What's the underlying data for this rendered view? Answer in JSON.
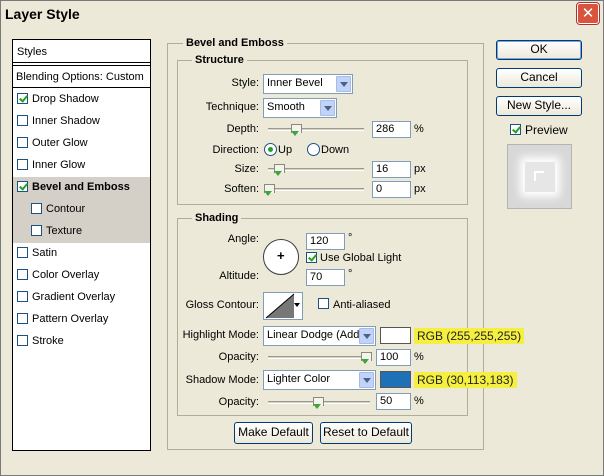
{
  "window": {
    "title": "Layer Style",
    "close_glyph": "✕"
  },
  "styles_list": {
    "header": "Styles",
    "blending": "Blending Options: Custom",
    "items": [
      {
        "label": "Drop Shadow",
        "checked": true
      },
      {
        "label": "Inner Shadow",
        "checked": false
      },
      {
        "label": "Outer Glow",
        "checked": false
      },
      {
        "label": "Inner Glow",
        "checked": false
      },
      {
        "label": "Bevel and Emboss",
        "checked": true,
        "active": true
      },
      {
        "label": "Contour",
        "checked": false,
        "sub": true
      },
      {
        "label": "Texture",
        "checked": false,
        "sub": true
      },
      {
        "label": "Satin",
        "checked": false
      },
      {
        "label": "Color Overlay",
        "checked": false
      },
      {
        "label": "Gradient Overlay",
        "checked": false
      },
      {
        "label": "Pattern Overlay",
        "checked": false
      },
      {
        "label": "Stroke",
        "checked": false
      }
    ]
  },
  "bevel": {
    "title": "Bevel and Emboss",
    "structure": {
      "title": "Structure",
      "style_label": "Style:",
      "style_value": "Inner Bevel",
      "technique_label": "Technique:",
      "technique_value": "Smooth",
      "depth_label": "Depth:",
      "depth_value": "286",
      "depth_unit": "%",
      "direction_label": "Direction:",
      "direction_up": "Up",
      "direction_down": "Down",
      "size_label": "Size:",
      "size_value": "16",
      "size_unit": "px",
      "soften_label": "Soften:",
      "soften_value": "0",
      "soften_unit": "px"
    },
    "shading": {
      "title": "Shading",
      "angle_label": "Angle:",
      "angle_value": "120",
      "angle_unit": "°",
      "global_light_label": "Use Global Light",
      "altitude_label": "Altitude:",
      "altitude_value": "70",
      "altitude_unit": "°",
      "gloss_label": "Gloss Contour:",
      "anti_aliased_label": "Anti-aliased",
      "highlight_mode_label": "Highlight Mode:",
      "highlight_mode_value": "Linear Dodge (Add)",
      "highlight_color": "#ffffff",
      "highlight_note": "RGB (255,255,255)",
      "highlight_opacity_label": "Opacity:",
      "highlight_opacity_value": "100",
      "highlight_opacity_unit": "%",
      "shadow_mode_label": "Shadow Mode:",
      "shadow_mode_value": "Lighter Color",
      "shadow_color": "#1e71b7",
      "shadow_note": "RGB (30,113,183)",
      "shadow_opacity_label": "Opacity:",
      "shadow_opacity_value": "50",
      "shadow_opacity_unit": "%"
    },
    "make_default": "Make Default",
    "reset_default": "Reset to Default"
  },
  "side_buttons": {
    "ok": "OK",
    "cancel": "Cancel",
    "new_style": "New Style...",
    "preview": "Preview"
  }
}
